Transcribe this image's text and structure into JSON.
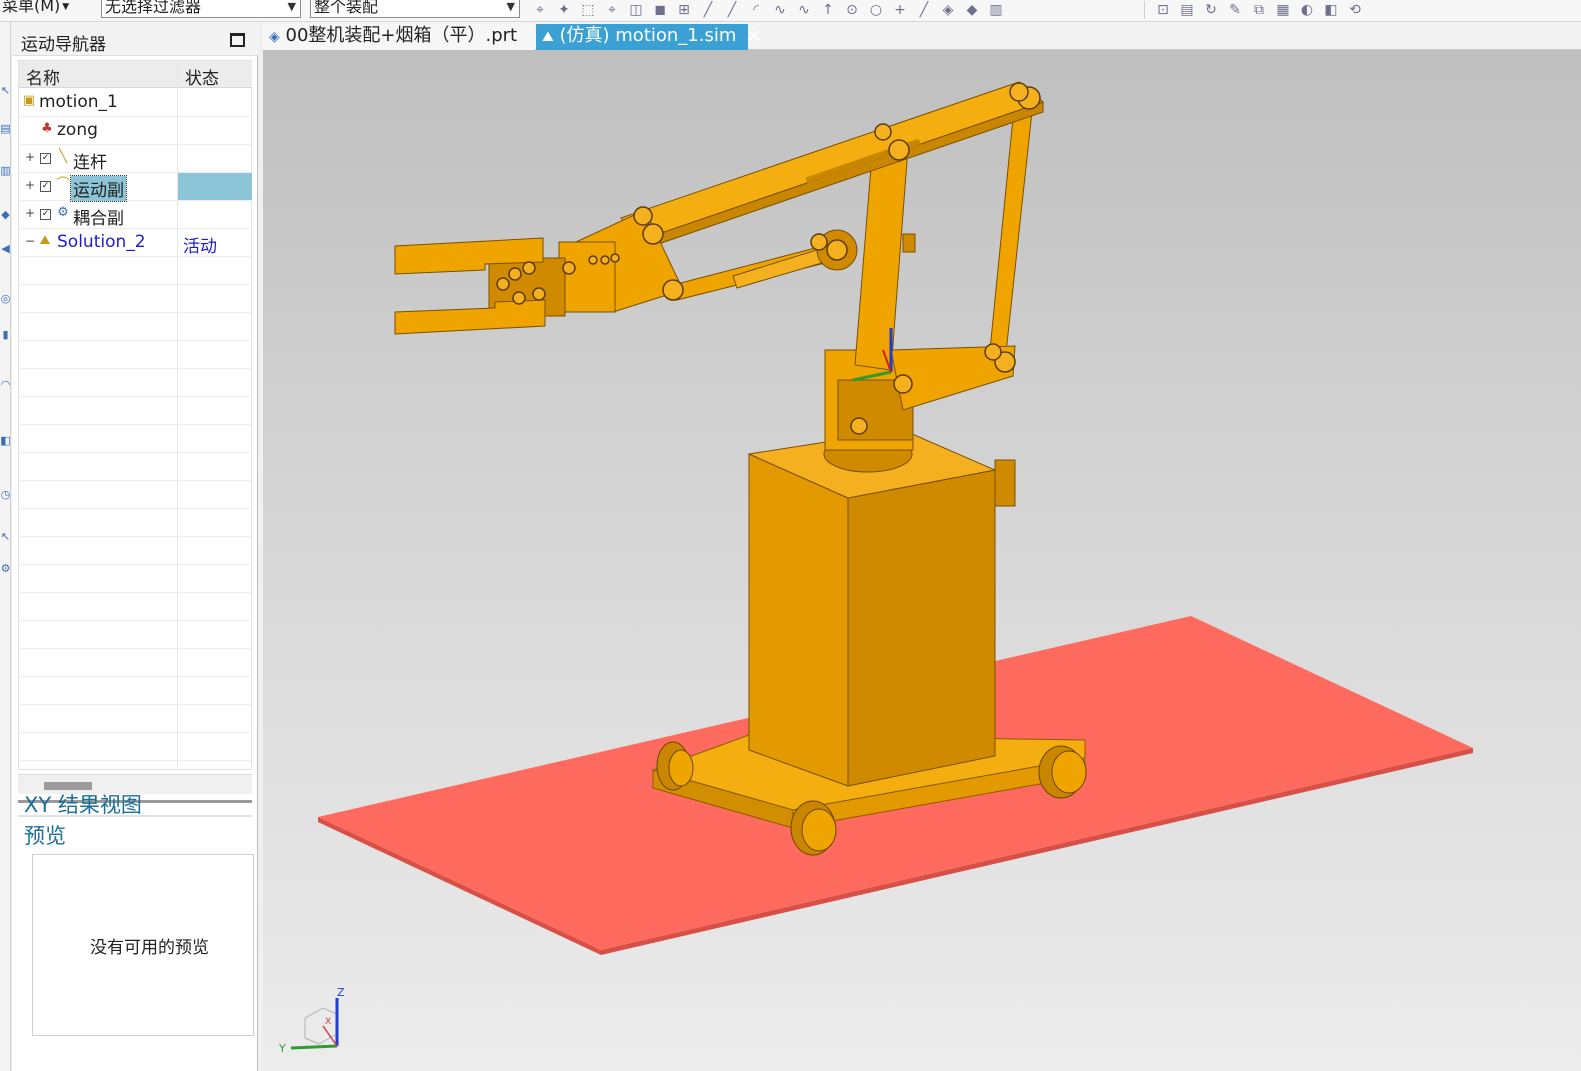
{
  "toolbar": {
    "menu_label": "菜单(M)",
    "filter_value": "无选择过滤器",
    "scope_value": "整个装配"
  },
  "navigator": {
    "title": "运动导航器",
    "columns": {
      "name": "名称",
      "status": "状态"
    },
    "rows": [
      {
        "label": "motion_1",
        "status": ""
      },
      {
        "label": "zong",
        "status": ""
      },
      {
        "label": "连杆",
        "status": ""
      },
      {
        "label": "运动副",
        "status": ""
      },
      {
        "label": "耦合副",
        "status": ""
      },
      {
        "label": "Solution_2",
        "status": "活动"
      }
    ]
  },
  "results": {
    "xy_title": "XY 结果视图",
    "preview_title": "预览",
    "preview_empty": "没有可用的预览"
  },
  "tabs": [
    {
      "label": "00整机装配+烟箱（平）.prt"
    },
    {
      "label": "(仿真) motion_1.sim",
      "close": "×"
    }
  ],
  "viewport": {
    "triad": {
      "z": "Z",
      "y": "Y",
      "x": "X"
    },
    "colors": {
      "model": "#f0a400",
      "model_dark": "#c98600",
      "floor": "#ff6a5e"
    }
  }
}
